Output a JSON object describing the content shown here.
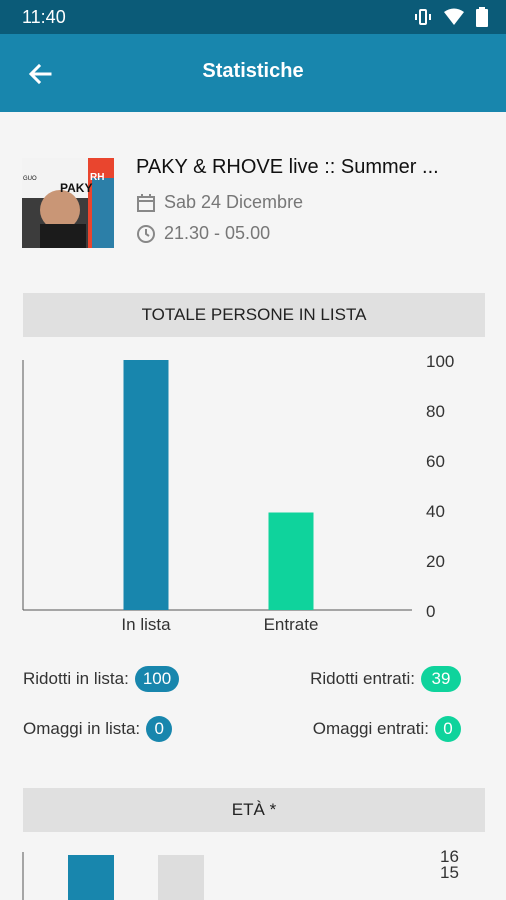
{
  "status_bar": {
    "time": "11:40"
  },
  "header": {
    "title": "Statistiche"
  },
  "event": {
    "name": "PAKY & RHOVE live :: Summer ...",
    "date": "Sab 24 Dicembre",
    "time": "21.30 - 05.00",
    "poster_text": {
      "artist_1": "PAKY",
      "artist_2": "RH",
      "tag": "GUO"
    }
  },
  "total_section": {
    "title": "TOTALE PERSONE IN LISTA"
  },
  "chart_data": [
    {
      "type": "bar",
      "categories": [
        "In lista",
        "Entrate"
      ],
      "values": [
        100,
        39
      ],
      "ylim": [
        0,
        100
      ],
      "yticks": [
        0,
        20,
        40,
        60,
        80,
        100
      ],
      "colors": [
        "#1886ad",
        "#0fd39c"
      ]
    },
    {
      "type": "bar",
      "values": [
        16,
        15
      ],
      "yticks_visible": [
        16,
        15
      ],
      "colors": [
        "#1886ad",
        "#dddddd"
      ]
    }
  ],
  "stats": {
    "ridotti_lista_label": "Ridotti in lista:",
    "ridotti_lista_value": "100",
    "ridotti_entrati_label": "Ridotti entrati:",
    "ridotti_entrati_value": "39",
    "omaggi_lista_label": "Omaggi in lista:",
    "omaggi_lista_value": "0",
    "omaggi_entrati_label": "Omaggi entrati:",
    "omaggi_entrati_value": "0"
  },
  "age_section": {
    "title": "ETÀ *"
  }
}
